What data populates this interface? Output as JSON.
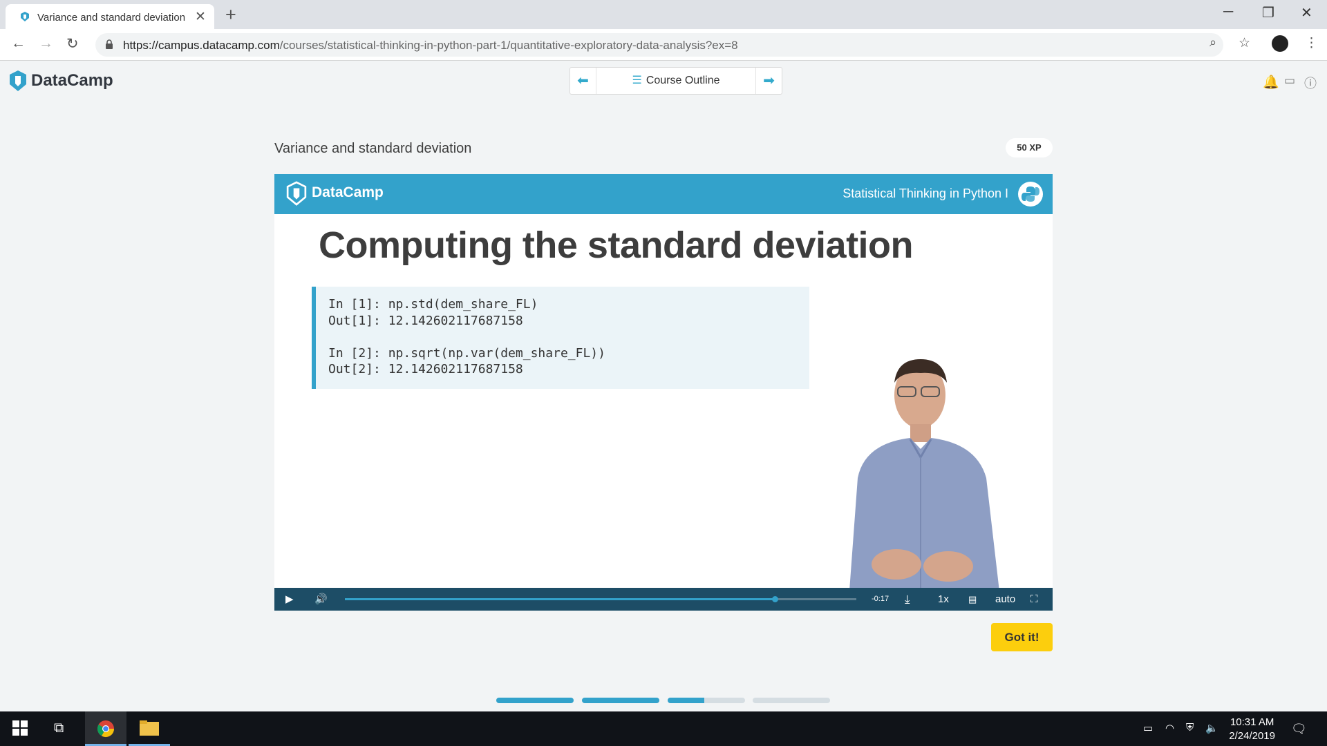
{
  "browser": {
    "tab_title": "Variance and standard deviation",
    "url_host": "https://campus.datacamp.com",
    "url_path": "/courses/statistical-thinking-in-python-part-1/quantitative-exploratory-data-analysis?ex=8"
  },
  "header": {
    "logo_text": "DataCamp",
    "outline_label": "Course Outline"
  },
  "exercise": {
    "title": "Variance and standard deviation",
    "xp": "50 XP",
    "got_it_label": "Got it!"
  },
  "slide": {
    "brand": "DataCamp",
    "course": "Statistical Thinking in Python I",
    "title": "Computing the standard deviation",
    "code": "In [1]: np.std(dem_share_FL)\nOut[1]: 12.142602117687158\n\nIn [2]: np.sqrt(np.var(dem_share_FL))\nOut[2]: 12.142602117687158"
  },
  "player": {
    "time_remaining": "-0:17",
    "speed": "1x",
    "quality": "auto",
    "progress": 0.84
  },
  "pagination": {
    "fills": [
      1,
      1,
      0.47,
      0
    ]
  },
  "taskbar": {
    "time": "10:31 AM",
    "date": "2/24/2019"
  },
  "colors": {
    "accent": "#33a2cb",
    "player_bar": "#1d4d66",
    "button_yellow": "#fcce0d"
  }
}
